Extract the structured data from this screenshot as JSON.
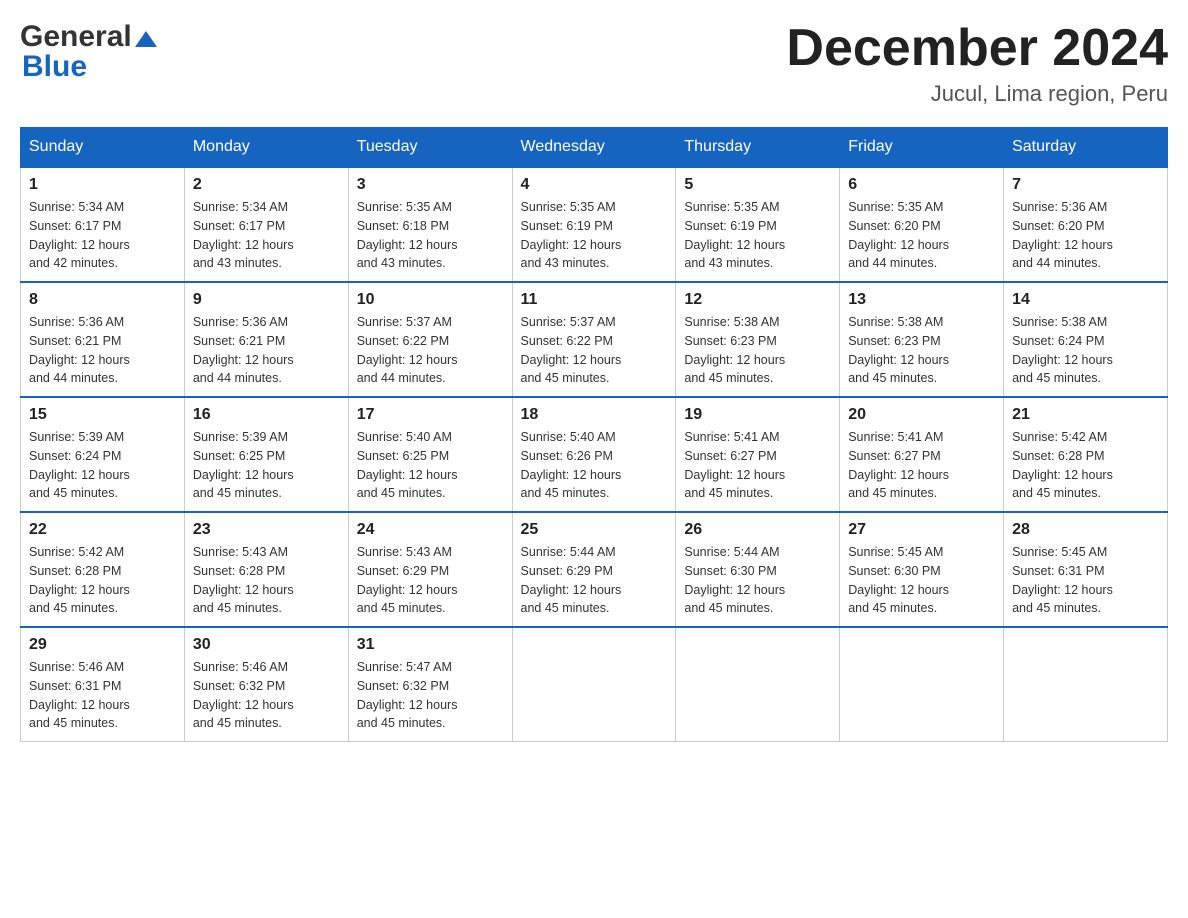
{
  "header": {
    "logo_general": "General",
    "logo_blue": "Blue",
    "month_title": "December 2024",
    "location": "Jucul, Lima region, Peru"
  },
  "days_of_week": [
    "Sunday",
    "Monday",
    "Tuesday",
    "Wednesday",
    "Thursday",
    "Friday",
    "Saturday"
  ],
  "weeks": [
    [
      {
        "day": "1",
        "sunrise": "5:34 AM",
        "sunset": "6:17 PM",
        "daylight": "12 hours and 42 minutes."
      },
      {
        "day": "2",
        "sunrise": "5:34 AM",
        "sunset": "6:17 PM",
        "daylight": "12 hours and 43 minutes."
      },
      {
        "day": "3",
        "sunrise": "5:35 AM",
        "sunset": "6:18 PM",
        "daylight": "12 hours and 43 minutes."
      },
      {
        "day": "4",
        "sunrise": "5:35 AM",
        "sunset": "6:19 PM",
        "daylight": "12 hours and 43 minutes."
      },
      {
        "day": "5",
        "sunrise": "5:35 AM",
        "sunset": "6:19 PM",
        "daylight": "12 hours and 43 minutes."
      },
      {
        "day": "6",
        "sunrise": "5:35 AM",
        "sunset": "6:20 PM",
        "daylight": "12 hours and 44 minutes."
      },
      {
        "day": "7",
        "sunrise": "5:36 AM",
        "sunset": "6:20 PM",
        "daylight": "12 hours and 44 minutes."
      }
    ],
    [
      {
        "day": "8",
        "sunrise": "5:36 AM",
        "sunset": "6:21 PM",
        "daylight": "12 hours and 44 minutes."
      },
      {
        "day": "9",
        "sunrise": "5:36 AM",
        "sunset": "6:21 PM",
        "daylight": "12 hours and 44 minutes."
      },
      {
        "day": "10",
        "sunrise": "5:37 AM",
        "sunset": "6:22 PM",
        "daylight": "12 hours and 44 minutes."
      },
      {
        "day": "11",
        "sunrise": "5:37 AM",
        "sunset": "6:22 PM",
        "daylight": "12 hours and 45 minutes."
      },
      {
        "day": "12",
        "sunrise": "5:38 AM",
        "sunset": "6:23 PM",
        "daylight": "12 hours and 45 minutes."
      },
      {
        "day": "13",
        "sunrise": "5:38 AM",
        "sunset": "6:23 PM",
        "daylight": "12 hours and 45 minutes."
      },
      {
        "day": "14",
        "sunrise": "5:38 AM",
        "sunset": "6:24 PM",
        "daylight": "12 hours and 45 minutes."
      }
    ],
    [
      {
        "day": "15",
        "sunrise": "5:39 AM",
        "sunset": "6:24 PM",
        "daylight": "12 hours and 45 minutes."
      },
      {
        "day": "16",
        "sunrise": "5:39 AM",
        "sunset": "6:25 PM",
        "daylight": "12 hours and 45 minutes."
      },
      {
        "day": "17",
        "sunrise": "5:40 AM",
        "sunset": "6:25 PM",
        "daylight": "12 hours and 45 minutes."
      },
      {
        "day": "18",
        "sunrise": "5:40 AM",
        "sunset": "6:26 PM",
        "daylight": "12 hours and 45 minutes."
      },
      {
        "day": "19",
        "sunrise": "5:41 AM",
        "sunset": "6:27 PM",
        "daylight": "12 hours and 45 minutes."
      },
      {
        "day": "20",
        "sunrise": "5:41 AM",
        "sunset": "6:27 PM",
        "daylight": "12 hours and 45 minutes."
      },
      {
        "day": "21",
        "sunrise": "5:42 AM",
        "sunset": "6:28 PM",
        "daylight": "12 hours and 45 minutes."
      }
    ],
    [
      {
        "day": "22",
        "sunrise": "5:42 AM",
        "sunset": "6:28 PM",
        "daylight": "12 hours and 45 minutes."
      },
      {
        "day": "23",
        "sunrise": "5:43 AM",
        "sunset": "6:28 PM",
        "daylight": "12 hours and 45 minutes."
      },
      {
        "day": "24",
        "sunrise": "5:43 AM",
        "sunset": "6:29 PM",
        "daylight": "12 hours and 45 minutes."
      },
      {
        "day": "25",
        "sunrise": "5:44 AM",
        "sunset": "6:29 PM",
        "daylight": "12 hours and 45 minutes."
      },
      {
        "day": "26",
        "sunrise": "5:44 AM",
        "sunset": "6:30 PM",
        "daylight": "12 hours and 45 minutes."
      },
      {
        "day": "27",
        "sunrise": "5:45 AM",
        "sunset": "6:30 PM",
        "daylight": "12 hours and 45 minutes."
      },
      {
        "day": "28",
        "sunrise": "5:45 AM",
        "sunset": "6:31 PM",
        "daylight": "12 hours and 45 minutes."
      }
    ],
    [
      {
        "day": "29",
        "sunrise": "5:46 AM",
        "sunset": "6:31 PM",
        "daylight": "12 hours and 45 minutes."
      },
      {
        "day": "30",
        "sunrise": "5:46 AM",
        "sunset": "6:32 PM",
        "daylight": "12 hours and 45 minutes."
      },
      {
        "day": "31",
        "sunrise": "5:47 AM",
        "sunset": "6:32 PM",
        "daylight": "12 hours and 45 minutes."
      },
      null,
      null,
      null,
      null
    ]
  ],
  "labels": {
    "sunrise": "Sunrise:",
    "sunset": "Sunset:",
    "daylight": "Daylight:"
  }
}
